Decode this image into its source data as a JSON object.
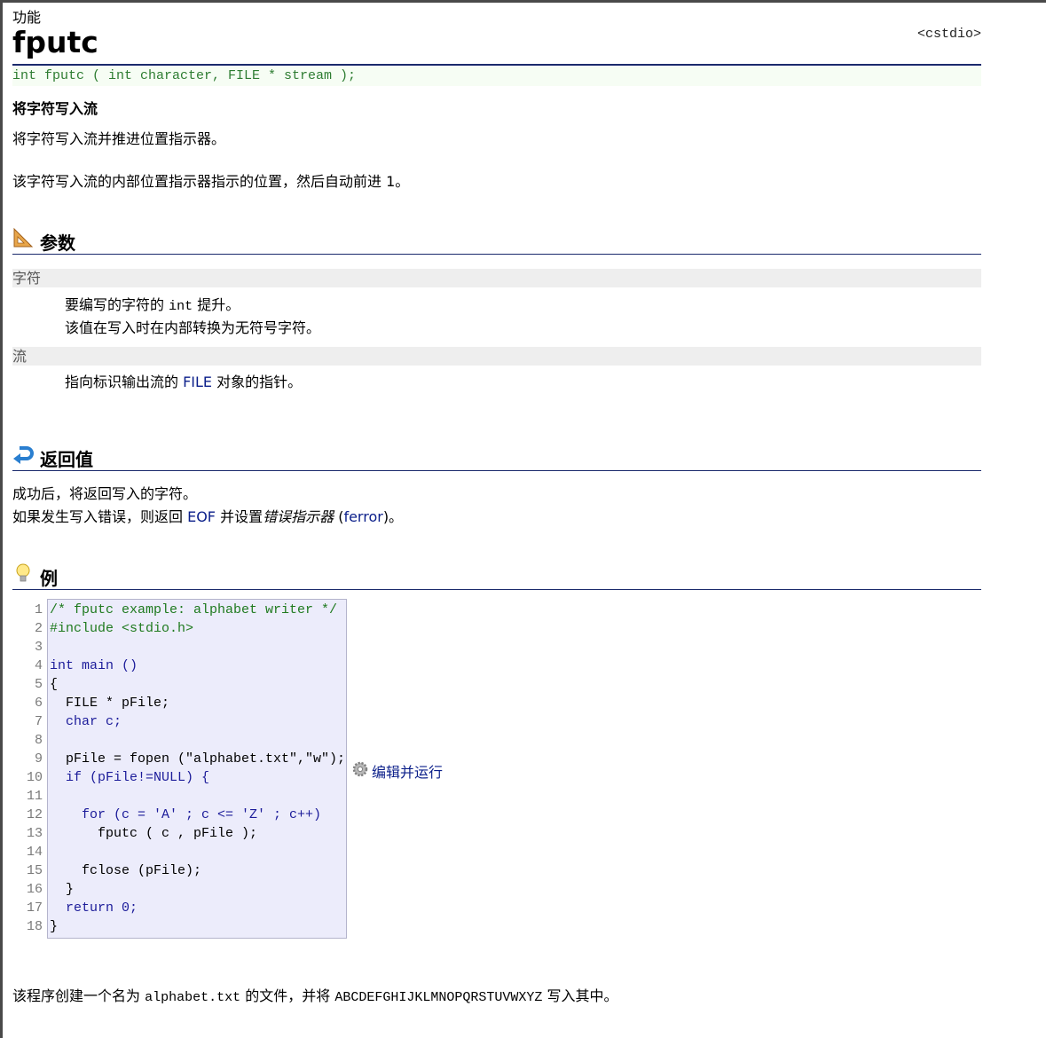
{
  "page": {
    "category": "功能",
    "title": "fputc",
    "header_file": "<cstdio>",
    "prototype": "int fputc ( int character, FILE * stream );",
    "summary_title": "将字符写入流",
    "description_1": "将字符写入流并推进位置指示器。",
    "description_2": "该字符写入流的内部位置指示器指示的位置，然后自动前进 1。"
  },
  "parameters": {
    "heading": "参数",
    "items": [
      {
        "name": "字符",
        "line1_pre": "要编写的字符的 ",
        "line1_code": "int",
        "line1_post": " 提升。",
        "line2": "该值在写入时在内部转换为无符号字符。"
      },
      {
        "name": "流",
        "line1_pre": "指向标识输出流的 ",
        "line1_link": "FILE",
        "line1_post": " 对象的指针。"
      }
    ]
  },
  "return_value": {
    "heading": "返回值",
    "line1": "成功后，将返回写入的字符。",
    "line2_pre": "如果发生写入错误，则返回 ",
    "line2_link1": "EOF",
    "line2_mid": " 并设置",
    "line2_em": "错误指示器",
    "line2_paren_open": " (",
    "line2_link2": "ferror",
    "line2_post": ")。"
  },
  "example": {
    "heading": "例",
    "run_label": "编辑并运行",
    "line_numbers": [
      "1",
      "2",
      "3",
      "4",
      "5",
      "6",
      "7",
      "8",
      "9",
      "10",
      "11",
      "12",
      "13",
      "14",
      "15",
      "16",
      "17",
      "18"
    ],
    "code_lines": [
      "/* fputc example: alphabet writer */",
      "#include <stdio.h>",
      "",
      "int main ()",
      "{",
      "  FILE * pFile;",
      "  char c;",
      "",
      "  pFile = fopen (\"alphabet.txt\",\"w\");",
      "  if (pFile!=NULL) {",
      "",
      "    for (c = 'A' ; c <= 'Z' ; c++)",
      "      fputc ( c , pFile );",
      "",
      "    fclose (pFile);",
      "  }",
      "  return 0;",
      "}"
    ],
    "footer_pre": "该程序创建一个名为 ",
    "footer_file": "alphabet.txt",
    "footer_mid": " 的文件，并将 ",
    "footer_alpha": "ABCDEFGHIJKLMNOPQRSTUVWXYZ",
    "footer_post": " 写入其中。"
  },
  "colors": {
    "heading_rule": "#1a2a6c",
    "link": "#0b1f8a",
    "prototype": "#2e7d32",
    "code_bg": "#ececfb"
  }
}
